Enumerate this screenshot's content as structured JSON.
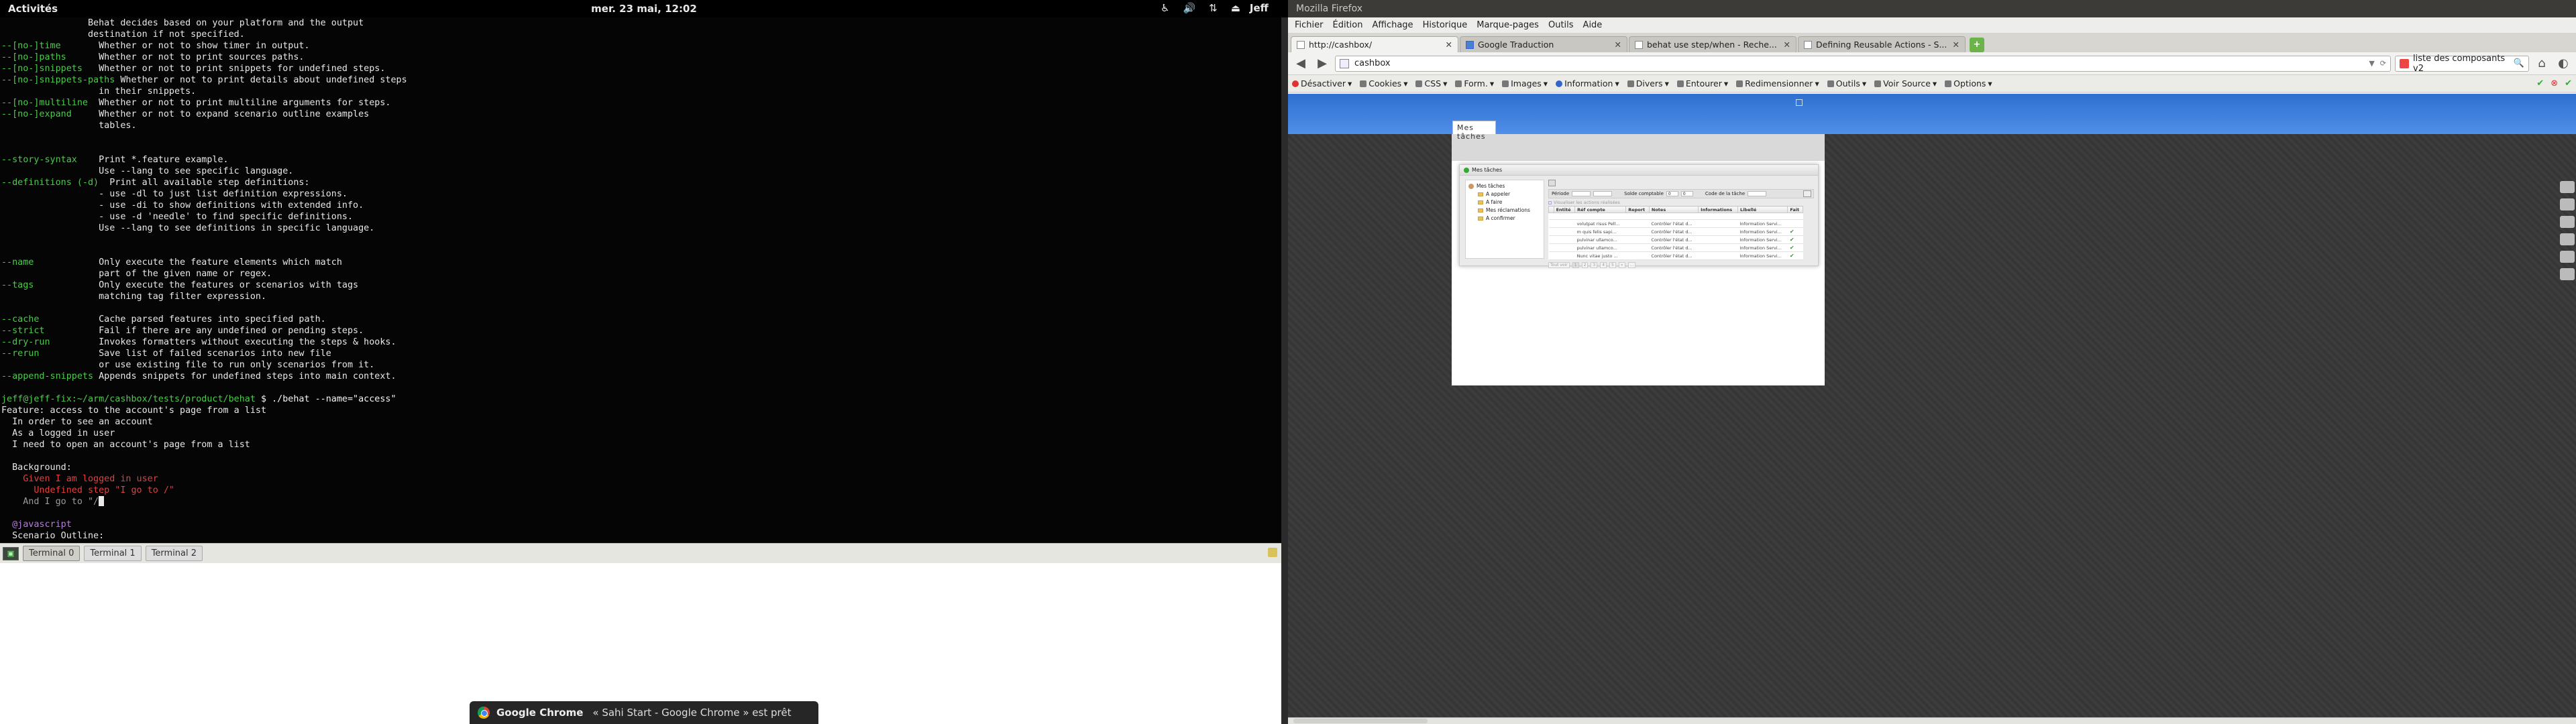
{
  "topbar": {
    "activities": "Activités",
    "clock": "mer. 23 mai, 12:02",
    "user": "Jeff",
    "tray_icons": [
      "accessibility-icon",
      "volume-icon",
      "network-icon",
      "usb-icon"
    ]
  },
  "terminal": {
    "lines": [
      {
        "text": "                Behat decides based on your platform and the output",
        "c": ""
      },
      {
        "text": "                destination if not specified.",
        "c": ""
      },
      {
        "text": "--[no-]time       Whether or not to show timer in output.",
        "c": "opt"
      },
      {
        "text": "--[no-]paths      Whether or not to print sources paths.",
        "c": "opt"
      },
      {
        "text": "--[no-]snippets   Whether or not to print snippets for undefined steps.",
        "c": "opt"
      },
      {
        "text": "--[no-]snippets-paths Whether or not to print details about undefined steps",
        "c": "opt"
      },
      {
        "text": "                  in their snippets.",
        "c": ""
      },
      {
        "text": "--[no-]multiline  Whether or not to print multiline arguments for steps.",
        "c": "opt"
      },
      {
        "text": "--[no-]expand     Whether or not to expand scenario outline examples",
        "c": "opt"
      },
      {
        "text": "                  tables.",
        "c": ""
      },
      {
        "text": "",
        "c": ""
      },
      {
        "text": "",
        "c": ""
      },
      {
        "text": "--story-syntax    Print *.feature example.",
        "c": "opt"
      },
      {
        "text": "                  Use --lang to see specific language.",
        "c": ""
      },
      {
        "text": "--definitions (-d)  Print all available step definitions:",
        "c": "opt"
      },
      {
        "text": "                  - use -dl to just list definition expressions.",
        "c": ""
      },
      {
        "text": "                  - use -di to show definitions with extended info.",
        "c": ""
      },
      {
        "text": "                  - use -d 'needle' to find specific definitions.",
        "c": ""
      },
      {
        "text": "                  Use --lang to see definitions in specific language.",
        "c": ""
      },
      {
        "text": "",
        "c": ""
      },
      {
        "text": "",
        "c": ""
      },
      {
        "text": "--name            Only execute the feature elements which match",
        "c": "opt"
      },
      {
        "text": "                  part of the given name or regex.",
        "c": ""
      },
      {
        "text": "--tags            Only execute the features or scenarios with tags",
        "c": "opt"
      },
      {
        "text": "                  matching tag filter expression.",
        "c": ""
      },
      {
        "text": "",
        "c": ""
      },
      {
        "text": "--cache           Cache parsed features into specified path.",
        "c": "opt"
      },
      {
        "text": "--strict          Fail if there are any undefined or pending steps.",
        "c": "opt"
      },
      {
        "text": "--dry-run         Invokes formatters without executing the steps & hooks.",
        "c": "opt"
      },
      {
        "text": "--rerun           Save list of failed scenarios into new file",
        "c": "opt"
      },
      {
        "text": "                  or use existing file to run only scenarios from it.",
        "c": ""
      },
      {
        "text": "--append-snippets Appends snippets for undefined steps into main context.",
        "c": "opt"
      },
      {
        "text": "",
        "c": ""
      },
      {
        "text": "jeff@jeff-fix:~/arm/cashbox/tests/product/behat $ ./behat --name=\"access\"",
        "c": "prompt"
      },
      {
        "text": "Feature: access to the account's page from a list",
        "c": ""
      },
      {
        "text": "  In order to see an account",
        "c": ""
      },
      {
        "text": "  As a logged in user",
        "c": ""
      },
      {
        "text": "  I need to open an account's page from a list",
        "c": ""
      },
      {
        "text": "",
        "c": ""
      },
      {
        "text": "  Background:",
        "c": ""
      },
      {
        "text": "    Given I am logged in user",
        "c": "red"
      },
      {
        "text": "      Undefined step \"I go to /\"",
        "c": "red"
      },
      {
        "text": "    And I go to \"/",
        "c": "cursor"
      },
      {
        "text": "",
        "c": ""
      },
      {
        "text": "  @javascript",
        "c": "grey"
      },
      {
        "text": "  Scenario Outline:",
        "c": ""
      }
    ],
    "tabs": [
      "Terminal 0",
      "Terminal 1",
      "Terminal 2"
    ],
    "active_tab": 0
  },
  "notification": {
    "app": "Google Chrome",
    "message": "« Sahi Start - Google Chrome » est prêt"
  },
  "firefox": {
    "title": "Mozilla Firefox",
    "menu": [
      "Fichier",
      "Édition",
      "Affichage",
      "Historique",
      "Marque-pages",
      "Outils",
      "Aide"
    ],
    "tabs": [
      {
        "label": "http://cashbox/",
        "active": true
      },
      {
        "label": "Google Traduction",
        "active": false
      },
      {
        "label": "behat use step/when - Reche...",
        "active": false
      },
      {
        "label": "Defining Reusable Actions - S...",
        "active": false
      }
    ],
    "url": "cashbox",
    "search": "liste des composants v2",
    "webdev": [
      "Désactiver",
      "Cookies",
      "CSS",
      "Form.",
      "Images",
      "Information",
      "Divers",
      "Entourer",
      "Redimensionner",
      "Outils",
      "Voir Source",
      "Options"
    ]
  },
  "app": {
    "page_tab": "Mes tâches",
    "panel_title": "Mes tâches",
    "tree_root": "Mes tâches",
    "tree_items": [
      "A appeler",
      "A faire",
      "Mes réclamations",
      "A confirmer"
    ],
    "filters": {
      "periode": "Période",
      "solde": "Solde comptable",
      "solde_from": "0",
      "solde_to": "0",
      "code": "Code de la tâche"
    },
    "checkbox_label": "Visualiser les actions réalisées",
    "columns": [
      "",
      "Entité",
      "Réf compte",
      "Report",
      "Notes",
      "Informations",
      "Libellé",
      "Fait"
    ],
    "rows": [
      {
        "ref": "volutpat risus Pell...",
        "notes": "Contrôler l'état d...",
        "libelle": "Information Servi...",
        "fait": false
      },
      {
        "ref": "m quis felis sapi...",
        "notes": "Contrôler l'état d...",
        "libelle": "Information Servi...",
        "fait": true
      },
      {
        "ref": "pulvinar ullamco...",
        "notes": "Contrôler l'état d...",
        "libelle": "Information Servi...",
        "fait": true
      },
      {
        "ref": "pulvinar ullamco...",
        "notes": "Contrôler l'état d...",
        "libelle": "Information Servi...",
        "fait": true
      },
      {
        "ref": "Nunc vitae justo ...",
        "notes": "Contrôler l'état d...",
        "libelle": "Information Servi...",
        "fait": true
      }
    ],
    "pager": [
      "Tout voir",
      "1",
      "2",
      "3",
      "4",
      "5",
      "»",
      "..."
    ]
  }
}
